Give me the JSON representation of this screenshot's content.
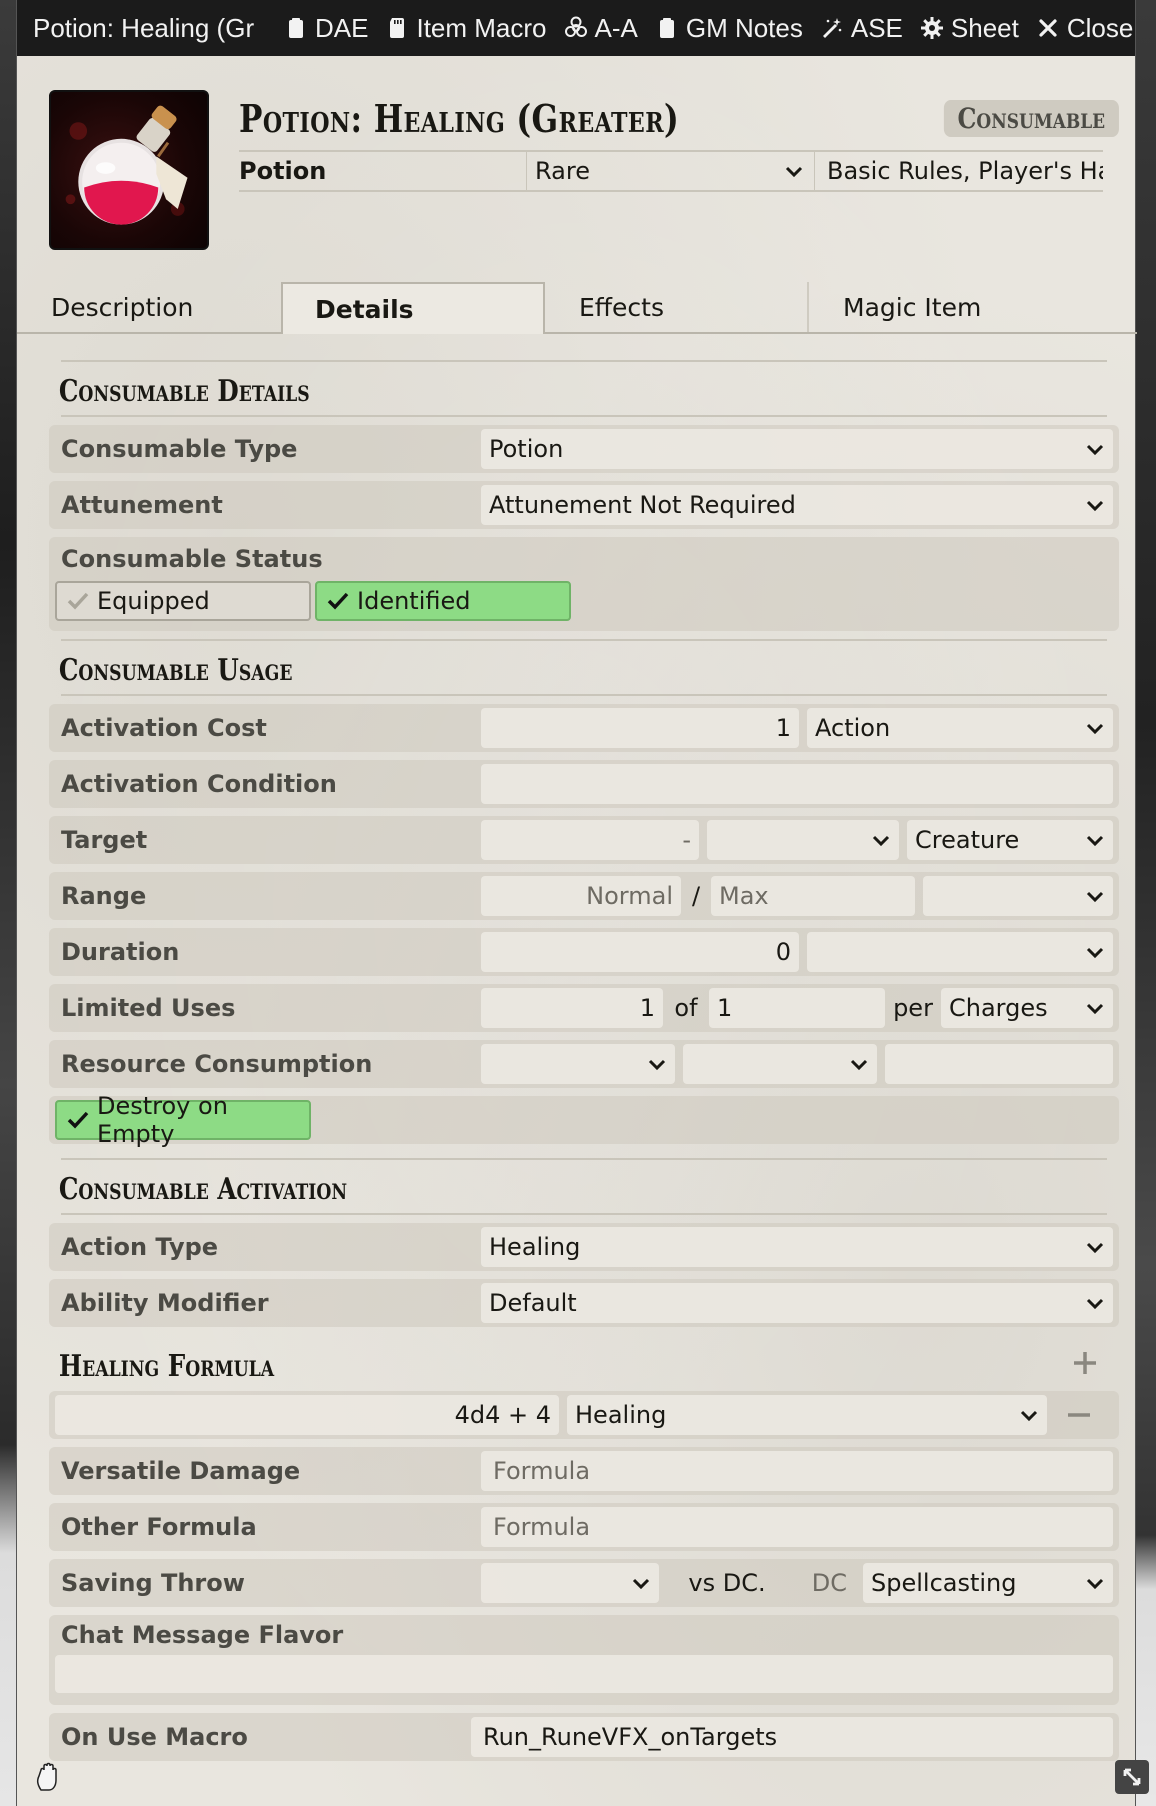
{
  "titlebar": {
    "title": "Potion: Healing (Gr",
    "buttons": [
      {
        "label": "DAE",
        "icon": "clipboard-icon"
      },
      {
        "label": "Item Macro",
        "icon": "sd-card-icon"
      },
      {
        "label": "A-A",
        "icon": "biohazard-icon"
      },
      {
        "label": "GM Notes",
        "icon": "clipboard-icon"
      },
      {
        "label": "ASE",
        "icon": "magic-wand-icon"
      },
      {
        "label": "Sheet",
        "icon": "gear-icon"
      },
      {
        "label": "Close",
        "icon": "close-icon"
      }
    ]
  },
  "header": {
    "name": "Potion: Healing (Greater)",
    "item_type": "Consumable",
    "subtype": "Potion",
    "rarity": "Rare",
    "source": "Basic Rules, Player's Ha"
  },
  "tabs": [
    "Description",
    "Details",
    "Effects",
    "Magic Item"
  ],
  "details": {
    "consumable_details_title": "Consumable Details",
    "consumable_type_label": "Consumable Type",
    "consumable_type_value": "Potion",
    "attunement_label": "Attunement",
    "attunement_value": "Attunement Not Required",
    "status_label": "Consumable Status",
    "equipped_label": "Equipped",
    "identified_label": "Identified",
    "usage_title": "Consumable Usage",
    "activation_cost_label": "Activation Cost",
    "activation_cost_value": "1",
    "activation_cost_type": "Action",
    "activation_condition_label": "Activation Condition",
    "activation_condition_value": "",
    "target_label": "Target",
    "target_value": "-",
    "target_units": "",
    "target_type": "Creature",
    "range_label": "Range",
    "range_normal_placeholder": "Normal",
    "range_sep": "/",
    "range_max_placeholder": "Max",
    "range_units": "",
    "duration_label": "Duration",
    "duration_value": "0",
    "duration_units": "",
    "uses_label": "Limited Uses",
    "uses_value": "1",
    "uses_of": "of",
    "uses_max": "1",
    "uses_per": "per",
    "uses_period": "Charges",
    "resource_label": "Resource Consumption",
    "destroy_label": "Destroy on Empty",
    "activation_title": "Consumable Activation",
    "action_type_label": "Action Type",
    "action_type_value": "Healing",
    "ability_label": "Ability Modifier",
    "ability_value": "Default",
    "healing_title": "Healing Formula",
    "healing_formula": "4d4 + 4",
    "healing_type": "Healing",
    "versatile_label": "Versatile Damage",
    "versatile_placeholder": "Formula",
    "other_label": "Other Formula",
    "other_placeholder": "Formula",
    "save_label": "Saving Throw",
    "save_vs": "vs DC.",
    "save_dc_placeholder": "DC",
    "save_scaling": "Spellcasting",
    "chat_flavor_label": "Chat Message Flavor",
    "chat_flavor_value": "",
    "macro_label": "On Use Macro",
    "macro_value": "Run_RuneVFX_onTargets"
  },
  "colors": {
    "titlebar": "#1b1b1b",
    "parchment": "#e9e6df",
    "checked": "#8ddb85"
  }
}
